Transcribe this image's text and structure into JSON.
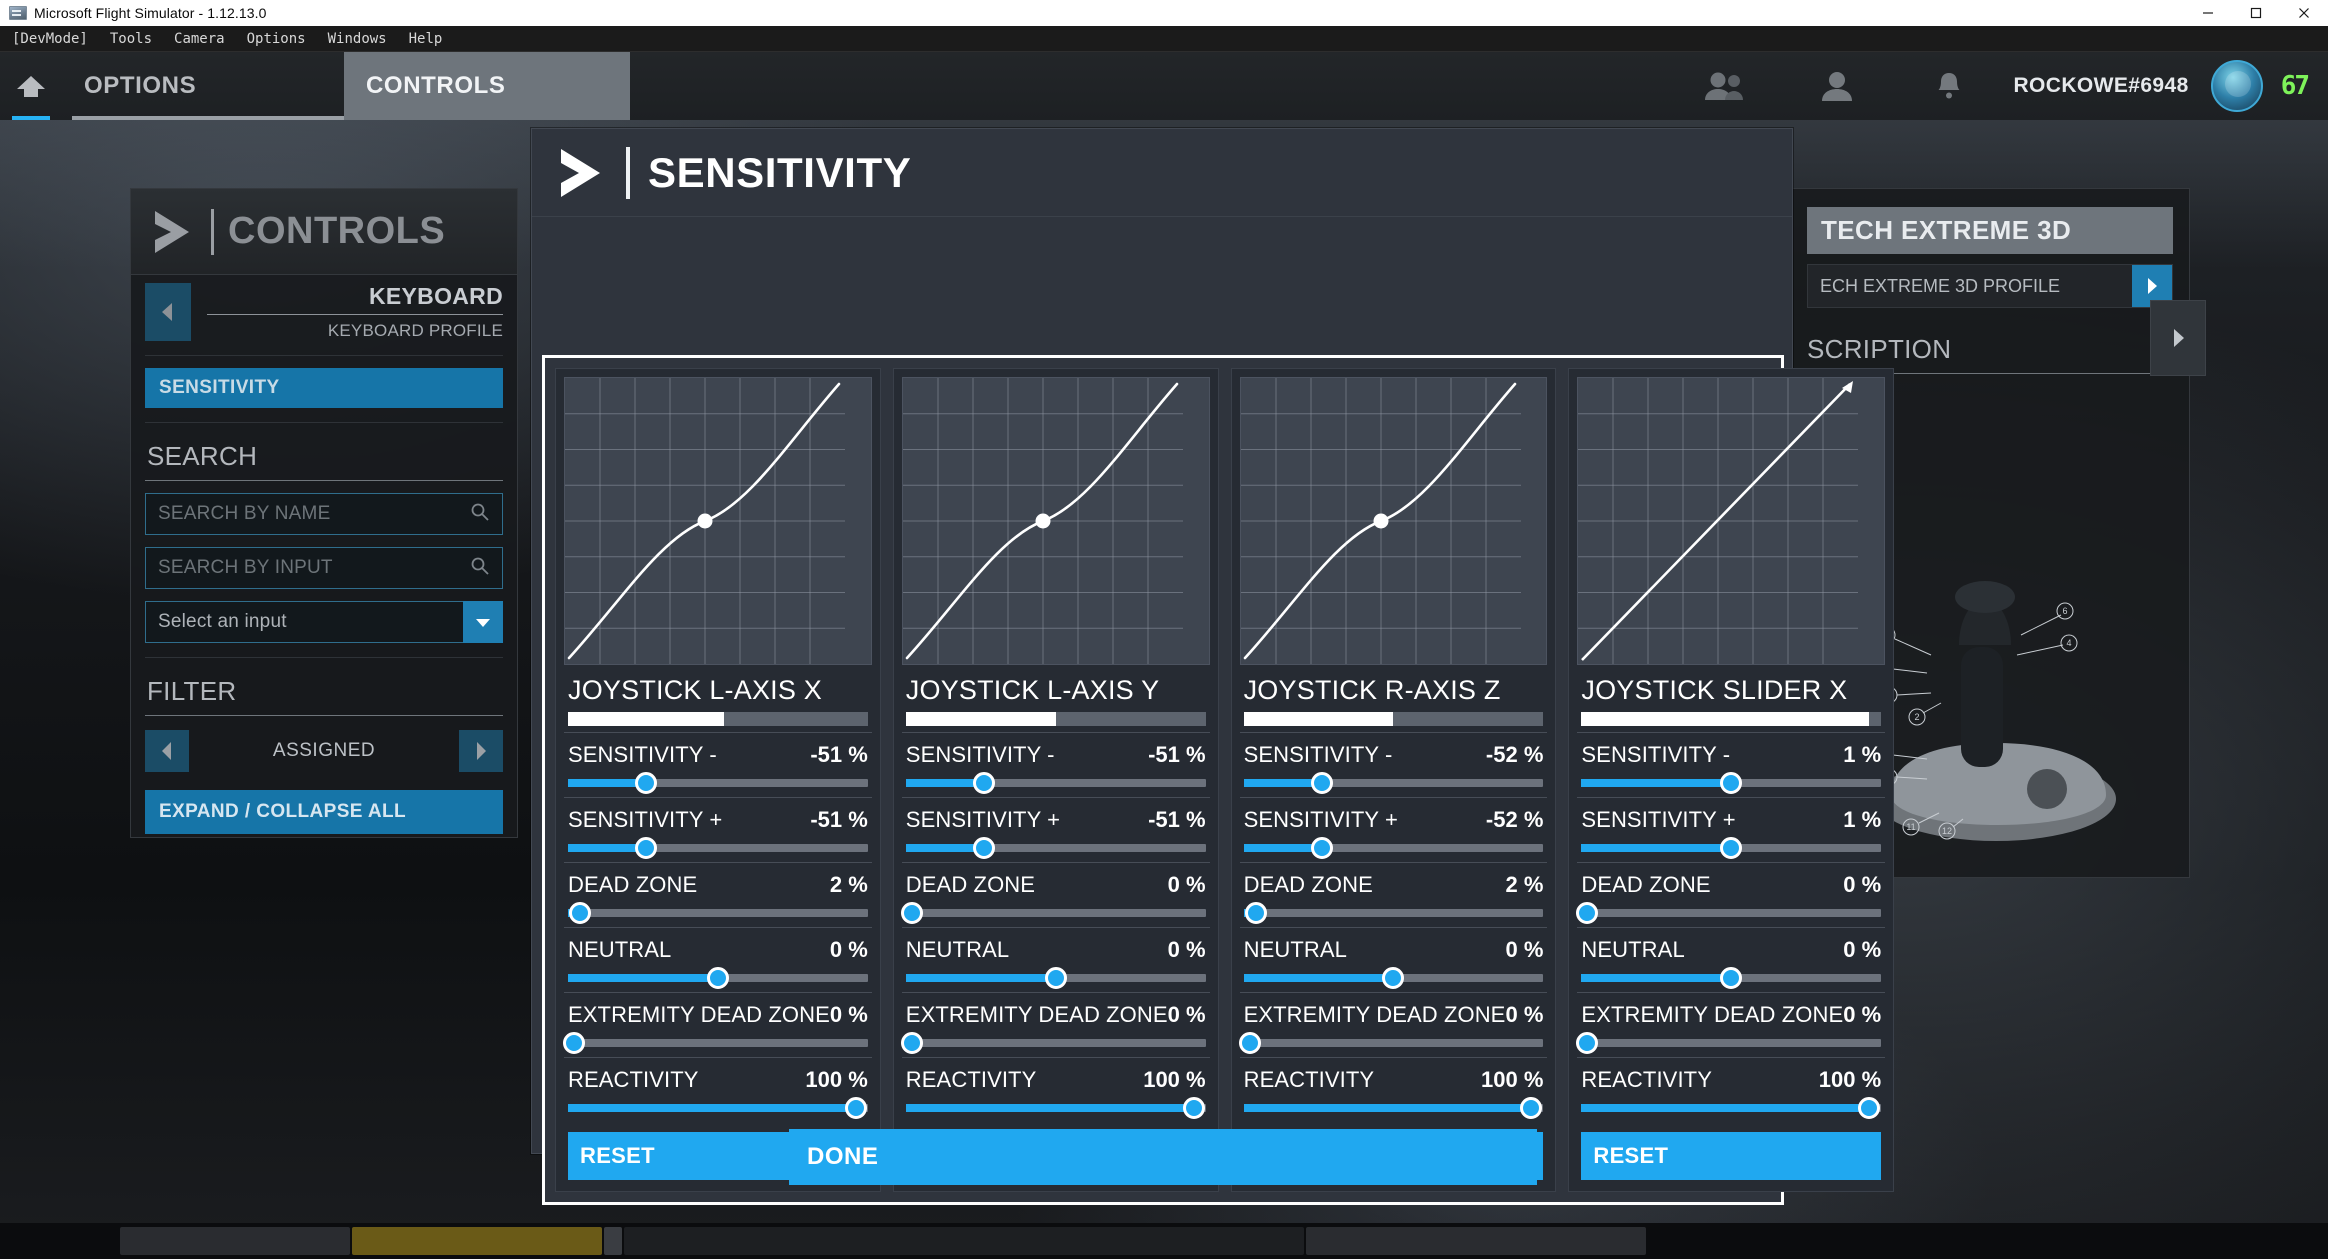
{
  "window": {
    "title": "Microsoft Flight Simulator - 1.12.13.0",
    "icon": "app-icon",
    "minimize": "minimize-icon",
    "maximize": "maximize-icon",
    "close": "close-icon"
  },
  "menubar": {
    "items": [
      "[DevMode]",
      "Tools",
      "Camera",
      "Options",
      "Windows",
      "Help"
    ]
  },
  "topnav": {
    "home_icon": "home-icon",
    "tabs": [
      {
        "label": "OPTIONS",
        "active": false
      },
      {
        "label": "CONTROLS",
        "active": true
      }
    ],
    "icons": [
      "friends-icon",
      "profile-icon",
      "notifications-icon"
    ],
    "username": "ROCKOWE#6948",
    "avatar": "avatar",
    "logo": "xbox-logo"
  },
  "left_panel": {
    "title": "CONTROLS",
    "chevron": "chevron-right-icon",
    "profile": {
      "prev_icon": "chevron-left-icon",
      "device": "KEYBOARD",
      "profile_label": "KEYBOARD PROFILE"
    },
    "selected_item": "SENSITIVITY",
    "search": {
      "title": "SEARCH",
      "by_name_placeholder": "SEARCH BY NAME",
      "by_input_placeholder": "SEARCH BY INPUT",
      "select_value": "Select an input",
      "search_icon": "search-icon",
      "caret_icon": "chevron-down-icon"
    },
    "filter": {
      "title": "FILTER",
      "prev_icon": "chevron-left-icon",
      "value": "ASSIGNED",
      "next_icon": "chevron-right-icon"
    },
    "expand_collapse": "EXPAND / COLLAPSE ALL"
  },
  "right_panel": {
    "device_title": "TECH EXTREME 3D",
    "profile_value": "ECH EXTREME 3D PROFILE",
    "profile_next_icon": "chevron-right-icon",
    "description_title": "SCRIPTION",
    "side_next_icon": "chevron-right-icon",
    "joystick_art": "joystick-illustration"
  },
  "modal": {
    "title": "SENSITIVITY",
    "chevron": "chevron-right-icon",
    "done_label": "DONE",
    "reset_label": "RESET",
    "axes": [
      {
        "name": "JOYSTICK L-AXIS X",
        "bar_percent": 52,
        "curve": "s-curve",
        "rows": [
          {
            "label": "SENSITIVITY -",
            "value": "-51 %",
            "pos": 26,
            "fill": true
          },
          {
            "label": "SENSITIVITY +",
            "value": "-51 %",
            "pos": 26,
            "fill": true
          },
          {
            "label": "DEAD ZONE",
            "value": "2 %",
            "pos": 4,
            "fill": true
          },
          {
            "label": "NEUTRAL",
            "value": "0 %",
            "pos": 50,
            "fill": true
          },
          {
            "label": "EXTREMITY DEAD ZONE",
            "value": "0 %",
            "pos": 2,
            "fill": true
          },
          {
            "label": "REACTIVITY",
            "value": "100 %",
            "pos": 96,
            "fill": true
          }
        ]
      },
      {
        "name": "JOYSTICK L-AXIS Y",
        "bar_percent": 50,
        "curve": "s-curve",
        "rows": [
          {
            "label": "SENSITIVITY -",
            "value": "-51 %",
            "pos": 26,
            "fill": true
          },
          {
            "label": "SENSITIVITY +",
            "value": "-51 %",
            "pos": 26,
            "fill": true
          },
          {
            "label": "DEAD ZONE",
            "value": "0 %",
            "pos": 2,
            "fill": true
          },
          {
            "label": "NEUTRAL",
            "value": "0 %",
            "pos": 50,
            "fill": true
          },
          {
            "label": "EXTREMITY DEAD ZONE",
            "value": "0 %",
            "pos": 2,
            "fill": true
          },
          {
            "label": "REACTIVITY",
            "value": "100 %",
            "pos": 96,
            "fill": true
          }
        ]
      },
      {
        "name": "JOYSTICK R-AXIS Z",
        "bar_percent": 50,
        "curve": "s-curve",
        "rows": [
          {
            "label": "SENSITIVITY -",
            "value": "-52 %",
            "pos": 26,
            "fill": true
          },
          {
            "label": "SENSITIVITY +",
            "value": "-52 %",
            "pos": 26,
            "fill": true
          },
          {
            "label": "DEAD ZONE",
            "value": "2 %",
            "pos": 4,
            "fill": true
          },
          {
            "label": "NEUTRAL",
            "value": "0 %",
            "pos": 50,
            "fill": true
          },
          {
            "label": "EXTREMITY DEAD ZONE",
            "value": "0 %",
            "pos": 2,
            "fill": true
          },
          {
            "label": "REACTIVITY",
            "value": "100 %",
            "pos": 96,
            "fill": true
          }
        ]
      },
      {
        "name": "JOYSTICK SLIDER X",
        "bar_percent": 96,
        "curve": "linear",
        "rows": [
          {
            "label": "SENSITIVITY -",
            "value": "1 %",
            "pos": 50,
            "fill": true
          },
          {
            "label": "SENSITIVITY +",
            "value": "1 %",
            "pos": 50,
            "fill": true
          },
          {
            "label": "DEAD ZONE",
            "value": "0 %",
            "pos": 2,
            "fill": true
          },
          {
            "label": "NEUTRAL",
            "value": "0 %",
            "pos": 50,
            "fill": true
          },
          {
            "label": "EXTREMITY DEAD ZONE",
            "value": "0 %",
            "pos": 2,
            "fill": true
          },
          {
            "label": "REACTIVITY",
            "value": "100 %",
            "pos": 96,
            "fill": true
          }
        ]
      }
    ]
  }
}
